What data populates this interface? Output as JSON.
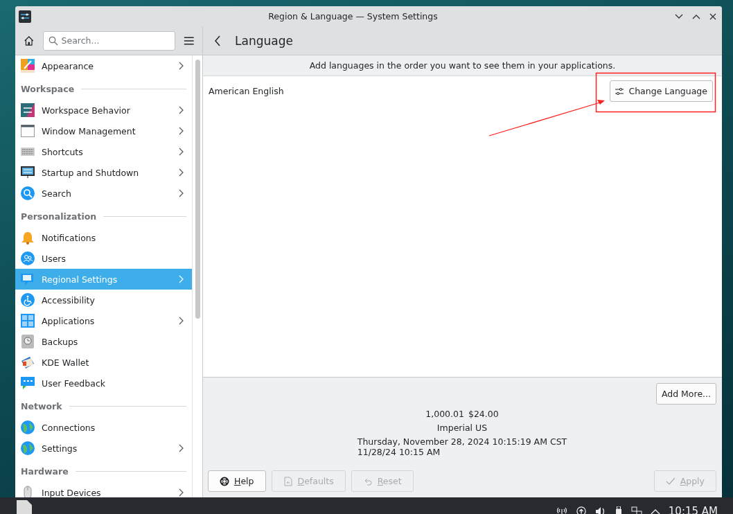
{
  "window": {
    "title": "Region & Language — System Settings"
  },
  "sidebar": {
    "search": {
      "placeholder": "Search..."
    },
    "sections": [
      {
        "items": [
          {
            "label": "Appearance",
            "has_submenu": true,
            "selected": false
          }
        ]
      },
      {
        "heading": "Workspace",
        "items": [
          {
            "label": "Workspace Behavior",
            "has_submenu": true,
            "selected": false
          },
          {
            "label": "Window Management",
            "has_submenu": true,
            "selected": false
          },
          {
            "label": "Shortcuts",
            "has_submenu": true,
            "selected": false
          },
          {
            "label": "Startup and Shutdown",
            "has_submenu": true,
            "selected": false
          },
          {
            "label": "Search",
            "has_submenu": true,
            "selected": false
          }
        ]
      },
      {
        "heading": "Personalization",
        "items": [
          {
            "label": "Notifications",
            "has_submenu": false,
            "selected": false
          },
          {
            "label": "Users",
            "has_submenu": false,
            "selected": false
          },
          {
            "label": "Regional Settings",
            "has_submenu": true,
            "selected": true
          },
          {
            "label": "Accessibility",
            "has_submenu": false,
            "selected": false
          },
          {
            "label": "Applications",
            "has_submenu": true,
            "selected": false
          },
          {
            "label": "Backups",
            "has_submenu": false,
            "selected": false
          },
          {
            "label": "KDE Wallet",
            "has_submenu": false,
            "selected": false
          },
          {
            "label": "User Feedback",
            "has_submenu": false,
            "selected": false
          }
        ]
      },
      {
        "heading": "Network",
        "items": [
          {
            "label": "Connections",
            "has_submenu": false,
            "selected": false
          },
          {
            "label": "Settings",
            "has_submenu": true,
            "selected": false
          }
        ]
      },
      {
        "heading": "Hardware",
        "items": [
          {
            "label": "Input Devices",
            "has_submenu": true,
            "selected": false
          }
        ]
      }
    ]
  },
  "page": {
    "title": "Language",
    "hint": "Add languages in the order you want to see them in your applications.",
    "languages": [
      {
        "name": "American English",
        "button": "Change Language"
      }
    ],
    "add_button": "Add More...",
    "preview": {
      "number": "1,000.01",
      "currency": "$24.00",
      "measurement": "Imperial US",
      "long_date": "Thursday, November 28, 2024 10:15:19 AM CST",
      "short_date": "11/28/24 10:15 AM"
    }
  },
  "footer": {
    "buttons": [
      {
        "label": "Help",
        "kind": "help",
        "disabled": false
      },
      {
        "label": "Defaults",
        "kind": "defaults",
        "disabled": true
      },
      {
        "label": "Reset",
        "kind": "reset",
        "disabled": true
      },
      {
        "label": "Apply",
        "kind": "apply",
        "disabled": true
      }
    ]
  },
  "taskbar": {
    "clock": "10:15 AM"
  }
}
